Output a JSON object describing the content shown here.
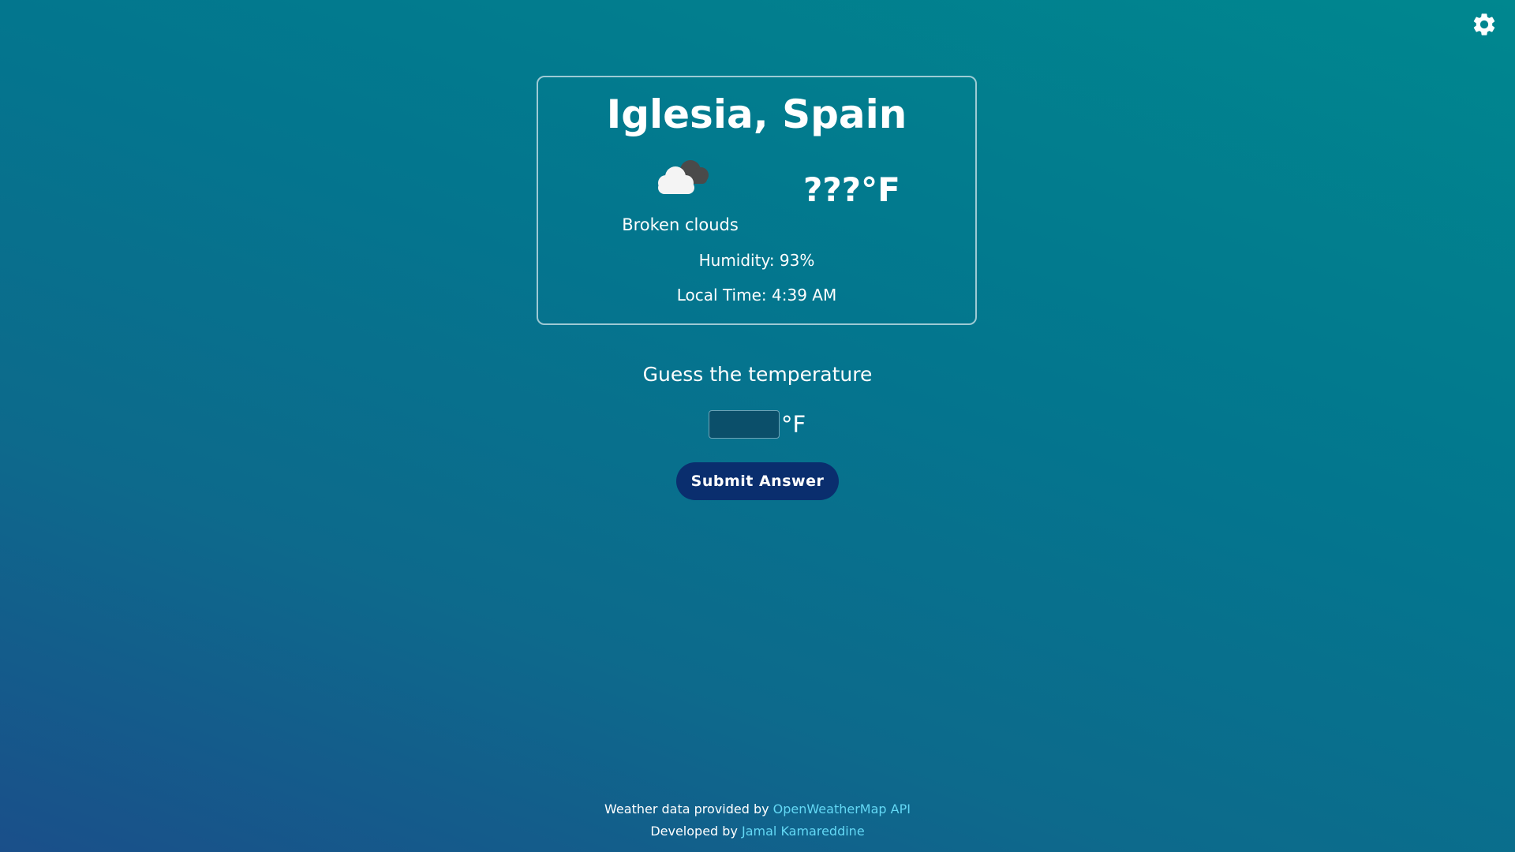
{
  "header": {
    "settings_icon": "gear-icon"
  },
  "weather_card": {
    "city": "Iglesia, Spain",
    "icon": "broken-clouds-icon",
    "description": "Broken clouds",
    "temperature": "???°F",
    "humidity": "Humidity: 93%",
    "local_time": "Local Time: 4:39 AM"
  },
  "guess": {
    "prompt": "Guess the temperature",
    "input_value": "",
    "unit": "°F",
    "submit_label": "Submit Answer"
  },
  "footer": {
    "line1_prefix": "Weather data provided by ",
    "line1_link": "OpenWeatherMap API",
    "line2_prefix": "Developed by ",
    "line2_link": "Jamal Kamareddine"
  },
  "colors": {
    "background_top": "#00878f",
    "background_bottom": "#1a4f8a",
    "button": "#0a2e6e",
    "link": "#63d8f5"
  }
}
